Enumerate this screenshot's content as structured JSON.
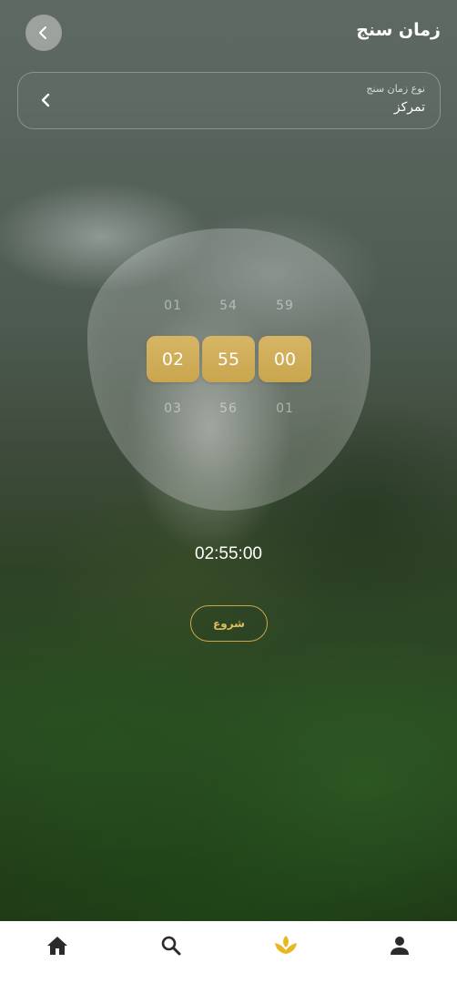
{
  "header": {
    "title": "زمان سنج",
    "back_icon": "chevron-left-icon"
  },
  "timer_type": {
    "label": "نوع زمان سنج",
    "value": "تمرکز",
    "chevron_icon": "chevron-left-icon"
  },
  "picker": {
    "hours": {
      "prev": "01",
      "selected": "02",
      "next": "03"
    },
    "minutes": {
      "prev": "54",
      "selected": "55",
      "next": "56"
    },
    "seconds": {
      "prev": "59",
      "selected": "00",
      "next": "01"
    }
  },
  "display": "02:55:00",
  "start_button": "شروع",
  "nav": {
    "items": [
      {
        "icon": "home-icon"
      },
      {
        "icon": "search-icon"
      },
      {
        "icon": "lotus-icon",
        "active": true
      },
      {
        "icon": "profile-icon"
      }
    ],
    "default_color": "#2b2b2b",
    "active_color": "#e8b820"
  },
  "colors": {
    "accent_gold": "#c9a64e",
    "start_text": "#e0be5e"
  }
}
